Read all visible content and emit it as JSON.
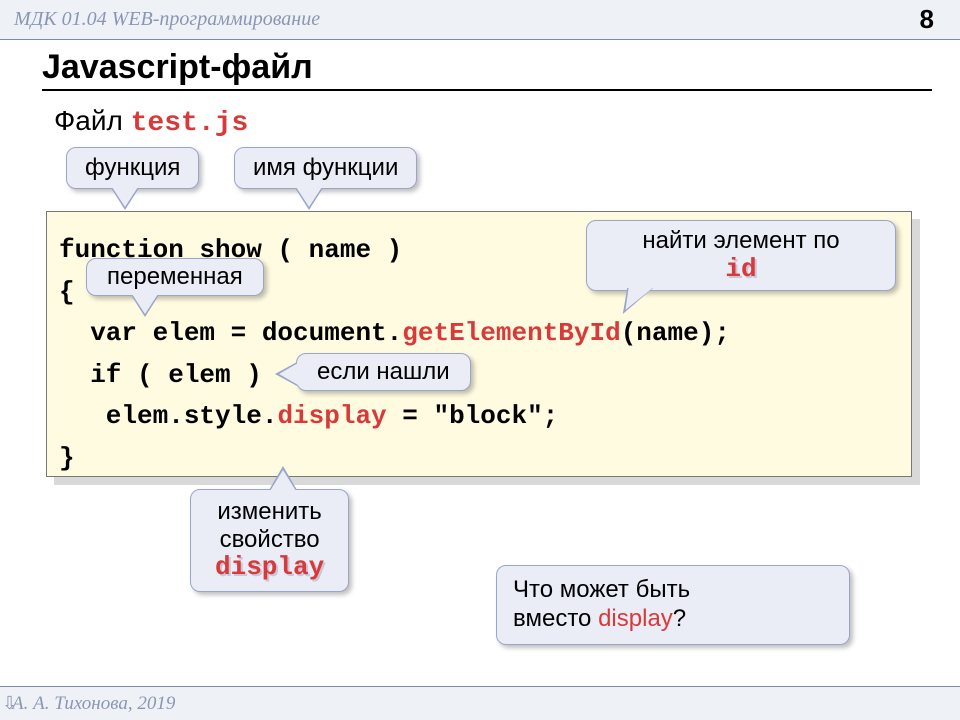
{
  "header": {
    "course": "МДК 01.04 WEB-программирование",
    "page": "8"
  },
  "title": "Javascript-файл",
  "subtitle": {
    "prefix": "Файл ",
    "filename": "test.js"
  },
  "callouts": {
    "c1": "функция",
    "c2": "имя функции",
    "c3": "переменная",
    "c4_line1": "найти элемент по",
    "c4_code": "id",
    "c5": "если нашли",
    "c6_line1": "изменить",
    "c6_line2": "свойство",
    "c6_code": "display",
    "c7_line1": "Что может быть",
    "c7_line2_a": "вместо ",
    "c7_line2_b": "display",
    "c7_line2_c": "?"
  },
  "code": {
    "l1a": "function show ( name )",
    "l2": "{",
    "l3a": "  var elem = document.",
    "l3b": "getElementById",
    "l3c": "(name);",
    "l4": "  if ( elem )",
    "l5a": "   elem.style.",
    "l5b": "display",
    "l5c": " = \"block\";",
    "l6": "}"
  },
  "footer": {
    "author": " А. А. Тихонова, 2019"
  }
}
